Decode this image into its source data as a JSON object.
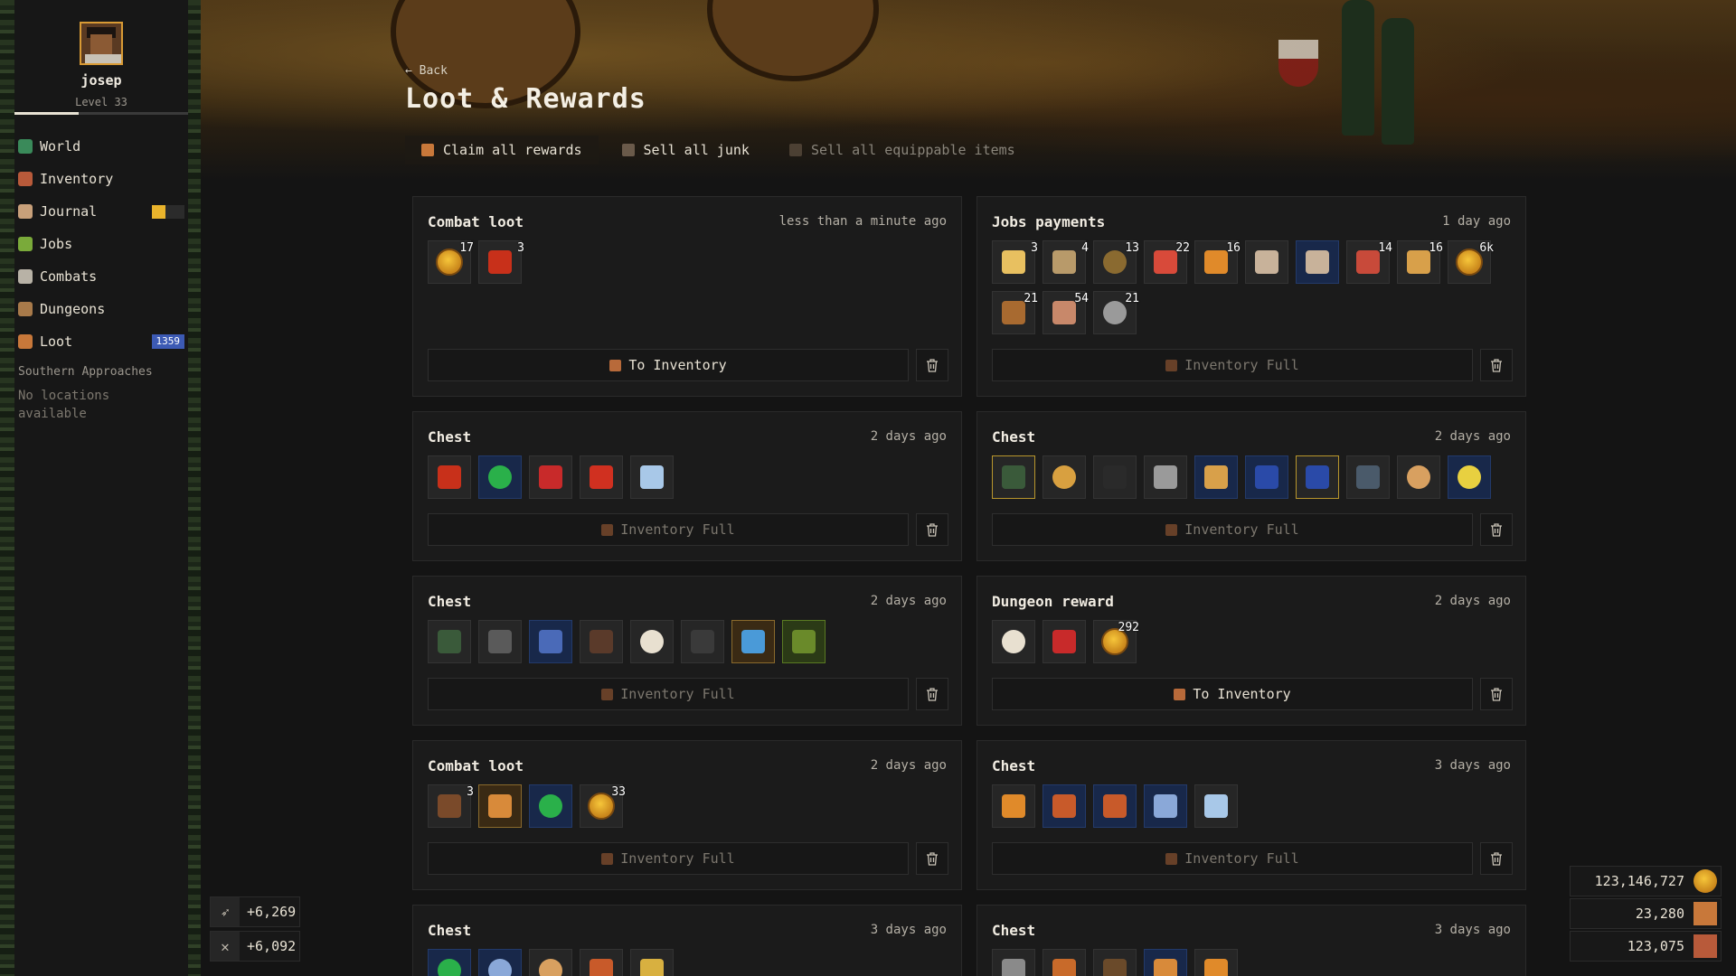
{
  "user": {
    "name": "josep",
    "level": "Level 33",
    "xp_fraction": 0.37
  },
  "nav": [
    {
      "label": "World",
      "icon": "globe-icon",
      "color": "#3a8a5a"
    },
    {
      "label": "Inventory",
      "icon": "backpack-icon",
      "color": "#b85a3a"
    },
    {
      "label": "Journal",
      "icon": "journal-icon",
      "color": "#c8a07a"
    },
    {
      "label": "Jobs",
      "icon": "jobs-icon",
      "color": "#7aaa3a"
    },
    {
      "label": "Combats",
      "icon": "crossed-swords-icon",
      "color": "#b8b2a6"
    },
    {
      "label": "Dungeons",
      "icon": "dungeon-icon",
      "color": "#a87a4a"
    },
    {
      "label": "Loot",
      "icon": "loot-icon",
      "color": "#c8783a",
      "badge": "1359"
    }
  ],
  "region": "Southern Approaches",
  "no_locations": "No locations available",
  "header": {
    "back": "← Back",
    "title": "Loot & Rewards",
    "actions": [
      "Claim all rewards",
      "Sell all junk",
      "Sell all equippable items"
    ]
  },
  "cards": [
    {
      "title": "Combat loot",
      "time": "less than a minute ago",
      "button": "To Inventory",
      "button_state": "active",
      "items": [
        {
          "icon": "coin-icon",
          "qty": "17",
          "color": "#f0b030"
        },
        {
          "icon": "feather-icon",
          "qty": "3",
          "color": "#c8301a"
        }
      ]
    },
    {
      "title": "Jobs payments",
      "time": "1 day ago",
      "button": "Inventory Full",
      "button_state": "disabled",
      "items": [
        {
          "icon": "card-icon",
          "qty": "3",
          "color": "#e8c060"
        },
        {
          "icon": "scroll-icon",
          "qty": "4",
          "color": "#b89a6a"
        },
        {
          "icon": "ore-icon",
          "qty": "13",
          "color": "#8a6a30"
        },
        {
          "icon": "medkit-icon",
          "qty": "22",
          "color": "#d84a3a"
        },
        {
          "icon": "bread-icon",
          "qty": "16",
          "color": "#e08a2a"
        },
        {
          "icon": "apron-icon",
          "qty": "",
          "color": "#c8b29a"
        },
        {
          "icon": "apron-icon",
          "qty": "",
          "color": "#c8b29a",
          "slot": "blue"
        },
        {
          "icon": "meat-icon",
          "qty": "14",
          "color": "#c84a3a"
        },
        {
          "icon": "planks-icon",
          "qty": "16",
          "color": "#d8a04a"
        },
        {
          "icon": "coin-icon",
          "qty": "6k",
          "color": "#f0b030"
        },
        {
          "icon": "crate-icon",
          "qty": "21",
          "color": "#a86a30"
        },
        {
          "icon": "thread-icon",
          "qty": "54",
          "color": "#c8886a"
        },
        {
          "icon": "stone-icon",
          "qty": "21",
          "color": "#9a9a9a"
        }
      ]
    },
    {
      "title": "Chest",
      "time": "2 days ago",
      "button": "Inventory Full",
      "button_state": "disabled",
      "items": [
        {
          "icon": "boots-icon",
          "qty": "",
          "color": "#c8301a"
        },
        {
          "icon": "amulet-icon",
          "qty": "",
          "color": "#2ab04a",
          "slot": "blue"
        },
        {
          "icon": "mask-icon",
          "qty": "",
          "color": "#c82a2a"
        },
        {
          "icon": "pepper-icon",
          "qty": "",
          "color": "#d03020"
        },
        {
          "icon": "ingot-icon",
          "qty": "",
          "color": "#a8c8e8"
        }
      ]
    },
    {
      "title": "Chest",
      "time": "2 days ago",
      "button": "Inventory Full",
      "button_state": "disabled",
      "items": [
        {
          "icon": "boots-icon",
          "qty": "",
          "color": "#3a5a3a",
          "slot": "gold"
        },
        {
          "icon": "ring-icon",
          "qty": "",
          "color": "#d8a040"
        },
        {
          "icon": "cloak-icon",
          "qty": "",
          "color": "#2a2a2a"
        },
        {
          "icon": "armor-icon",
          "qty": "",
          "color": "#9a9a9a"
        },
        {
          "icon": "planks-icon",
          "qty": "",
          "color": "#d8a04a",
          "slot": "blue"
        },
        {
          "icon": "pants-icon",
          "qty": "",
          "color": "#2a4aa8",
          "slot": "blue"
        },
        {
          "icon": "shield-icon",
          "qty": "",
          "color": "#2a4aa8",
          "slot": "gold"
        },
        {
          "icon": "pants-icon",
          "qty": "",
          "color": "#4a5a6a"
        },
        {
          "icon": "nuggets-icon",
          "qty": "",
          "color": "#d8a060"
        },
        {
          "icon": "gem-icon",
          "qty": "",
          "color": "#e8d040",
          "slot": "blue"
        }
      ]
    },
    {
      "title": "Chest",
      "time": "2 days ago",
      "button": "Inventory Full",
      "button_state": "disabled",
      "items": [
        {
          "icon": "shield-icon",
          "qty": "",
          "color": "#3a5a3a"
        },
        {
          "icon": "sword-icon",
          "qty": "",
          "color": "#5a5a5a"
        },
        {
          "icon": "dagger-icon",
          "qty": "",
          "color": "#4a6ab8",
          "slot": "blue"
        },
        {
          "icon": "stick-icon",
          "qty": "",
          "color": "#5a3a2a"
        },
        {
          "icon": "garlic-icon",
          "qty": "",
          "color": "#e8e0d0"
        },
        {
          "icon": "belt-icon",
          "qty": "",
          "color": "#3a3a3a"
        },
        {
          "icon": "boots-icon",
          "qty": "",
          "color": "#4a9ad8",
          "slot": "orange"
        },
        {
          "icon": "hat-icon",
          "qty": "",
          "color": "#6a8a2a",
          "slot": "green"
        }
      ]
    },
    {
      "title": "Dungeon reward",
      "time": "2 days ago",
      "button": "To Inventory",
      "button_state": "active",
      "items": [
        {
          "icon": "garlic-icon",
          "qty": "",
          "color": "#e8e0d0"
        },
        {
          "icon": "mask-icon",
          "qty": "",
          "color": "#c82a2a"
        },
        {
          "icon": "coin-icon",
          "qty": "292",
          "color": "#f0b030"
        }
      ]
    },
    {
      "title": "Combat loot",
      "time": "2 days ago",
      "button": "Inventory Full",
      "button_state": "disabled",
      "items": [
        {
          "icon": "club-icon",
          "qty": "3",
          "color": "#7a4a2a"
        },
        {
          "icon": "sword-icon",
          "qty": "",
          "color": "#d88a3a",
          "slot": "orange"
        },
        {
          "icon": "amulet-icon",
          "qty": "",
          "color": "#2ab04a",
          "slot": "blue"
        },
        {
          "icon": "coin-icon",
          "qty": "33",
          "color": "#f0b030"
        }
      ]
    },
    {
      "title": "Chest",
      "time": "3 days ago",
      "button": "Inventory Full",
      "button_state": "disabled",
      "items": [
        {
          "icon": "helmet-icon",
          "qty": "",
          "color": "#e08a2a"
        },
        {
          "icon": "planks-icon",
          "qty": "",
          "color": "#c85a2a",
          "slot": "blue"
        },
        {
          "icon": "brick-icon",
          "qty": "",
          "color": "#c85a2a",
          "slot": "blue"
        },
        {
          "icon": "hammer-icon",
          "qty": "",
          "color": "#8aa8d8",
          "slot": "blue"
        },
        {
          "icon": "ingot-icon",
          "qty": "",
          "color": "#a8c8e8"
        }
      ]
    },
    {
      "title": "Chest",
      "time": "3 days ago",
      "button": "",
      "button_state": "hidden",
      "items": [
        {
          "icon": "amulet-icon",
          "qty": "",
          "color": "#2ab04a",
          "slot": "blue"
        },
        {
          "icon": "ring-icon",
          "qty": "",
          "color": "#8aa8d8",
          "slot": "blue"
        },
        {
          "icon": "nuggets-icon",
          "qty": "",
          "color": "#d8a060"
        },
        {
          "icon": "potion-icon",
          "qty": "",
          "color": "#c85a2a"
        },
        {
          "icon": "wheat-icon",
          "qty": "",
          "color": "#d8b040"
        }
      ]
    },
    {
      "title": "Chest",
      "time": "3 days ago",
      "button": "",
      "button_state": "hidden",
      "items": [
        {
          "icon": "arrowhead-icon",
          "qty": "",
          "color": "#8a8a8a"
        },
        {
          "icon": "vest-icon",
          "qty": "",
          "color": "#c86a2a"
        },
        {
          "icon": "cloak-icon",
          "qty": "",
          "color": "#6a4a2a"
        },
        {
          "icon": "key-icon",
          "qty": "",
          "color": "#d88a3a",
          "slot": "blue"
        },
        {
          "icon": "bread-icon",
          "qty": "",
          "color": "#e08a2a"
        }
      ]
    }
  ],
  "stats": [
    {
      "icon": "bow-icon",
      "value": "+6,269"
    },
    {
      "icon": "crossed-swords-icon",
      "value": "+6,092"
    }
  ],
  "resources": [
    {
      "icon": "coin-icon",
      "value": "123,146,727",
      "color": "#f0b030"
    },
    {
      "icon": "chest-icon",
      "value": "23,280",
      "color": "#c8783a"
    },
    {
      "icon": "crate-icon",
      "value": "123,075",
      "color": "#b85a3a"
    }
  ]
}
